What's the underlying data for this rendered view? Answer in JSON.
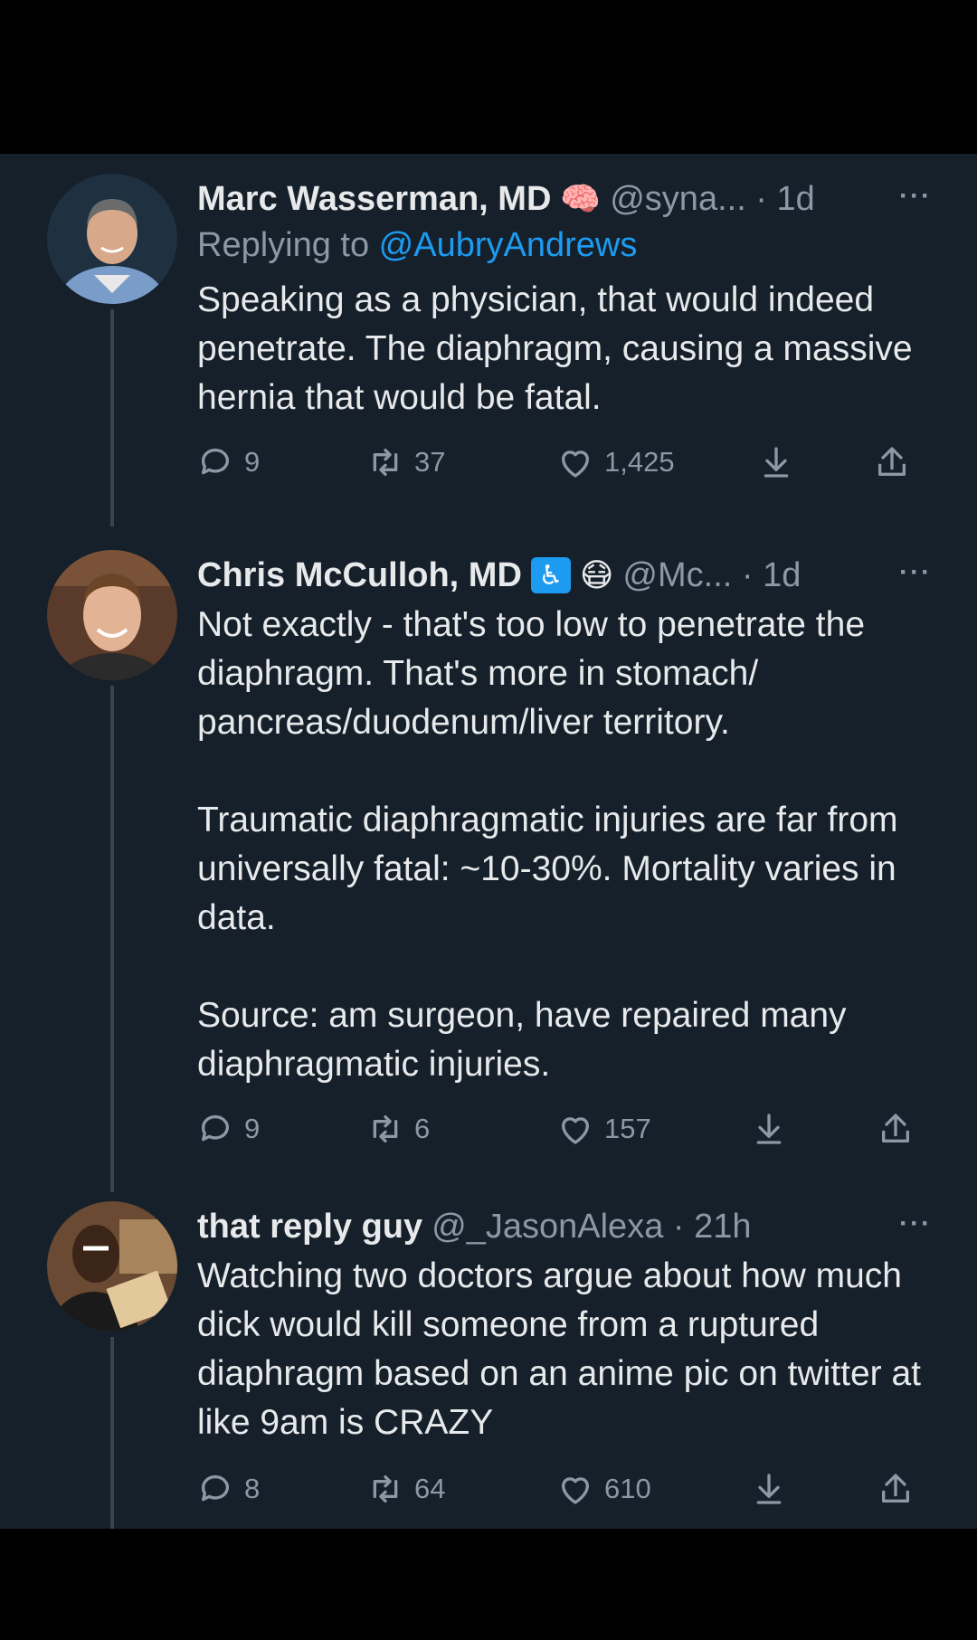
{
  "tweets": [
    {
      "name": "Marc Wasserman, MD",
      "emoji": "🧠",
      "handle": "@syna... · 1d",
      "more": "···",
      "reply_prefix": "Replying to ",
      "reply_to": "@AubryAndrews",
      "text": "Speaking as a physician, that would indeed penetrate.  The diaphragm, causing a massive hernia that would be fatal.",
      "replies": "9",
      "retweets": "37",
      "likes": "1,425"
    },
    {
      "name": "Chris McCulloh, MD",
      "badge_icon": "wheelchair-icon",
      "emoji": "😷",
      "handle": "@Mc... · 1d",
      "more": "···",
      "text": "Not exactly - that's too low to penetrate the diaphragm. That's more in stomach/ pancreas/duodenum/liver territory.\n\nTraumatic diaphragmatic injuries are far from universally fatal: ~10-30%. Mortality varies in data.\n\nSource: am surgeon, have repaired many diaphragmatic injuries.",
      "replies": "9",
      "retweets": "6",
      "likes": "157"
    },
    {
      "name": "that reply guy",
      "handle": "@_JasonAlexa · 21h",
      "more": "···",
      "text": "Watching two doctors argue about how much dick would kill someone from a ruptured diaphragm based on an anime pic on twitter at like 9am is CRAZY",
      "replies": "8",
      "retweets": "64",
      "likes": "610"
    }
  ],
  "colors": {
    "background": "#15202b",
    "text": "#e7e9ea",
    "secondary": "#8b98a5",
    "link": "#1d9bf0",
    "thread_line": "#38444d"
  }
}
